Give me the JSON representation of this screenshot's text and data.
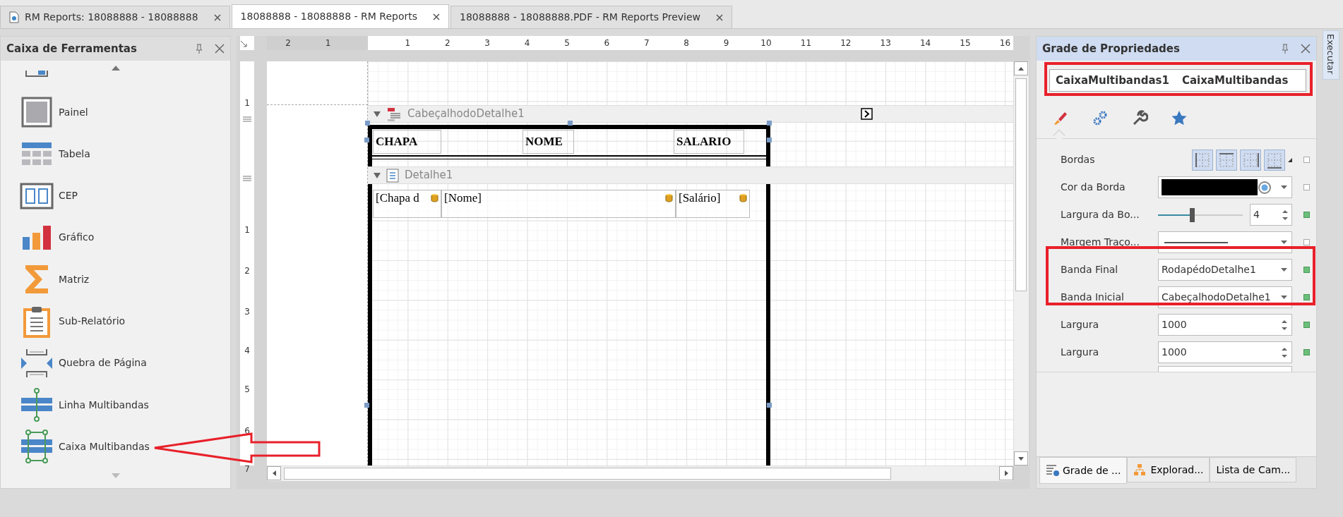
{
  "document_tabs": [
    {
      "label": "RM Reports:  18088888 - 18088888",
      "selected": false,
      "kind": "document"
    },
    {
      "label": "18088888 - 18088888 - RM Reports",
      "selected": true,
      "kind": "plain"
    },
    {
      "label": "18088888 - 18088888.PDF - RM Reports Preview",
      "selected": false,
      "kind": "plain"
    }
  ],
  "toolbox": {
    "title": "Caixa de Ferramentas",
    "items": [
      {
        "kind": "checkbox"
      },
      {
        "kind": "panel",
        "label": "Painel"
      },
      {
        "kind": "table",
        "label": "Tabela"
      },
      {
        "kind": "zip",
        "label": "CEP"
      },
      {
        "kind": "chart",
        "label": "Gráfico"
      },
      {
        "kind": "matrix",
        "label": "Matriz"
      },
      {
        "kind": "subreport",
        "label": "Sub-Relatório"
      },
      {
        "kind": "pagebreak",
        "label": "Quebra de Página"
      },
      {
        "kind": "crossline",
        "label": "Linha Multibandas"
      },
      {
        "kind": "crossbox",
        "label": "Caixa Multibandas"
      }
    ]
  },
  "ruler": {
    "horizontal": [
      "2",
      "1",
      "1",
      "2",
      "3",
      "4",
      "5",
      "6",
      "7",
      "8",
      "9",
      "10",
      "11",
      "12",
      "13",
      "14",
      "15",
      "16"
    ],
    "vertical": [
      "1",
      "1",
      "2",
      "3",
      "4",
      "5",
      "6",
      "7"
    ]
  },
  "design": {
    "bands": [
      {
        "kind": "header",
        "name": "CabeçalhodoDetalhe1",
        "cells": [
          "CHAPA",
          "NOME",
          "SALARIO"
        ]
      },
      {
        "kind": "detail",
        "name": "Detalhe1",
        "cells": [
          "[Chapa d",
          "[Nome]",
          "[Salário]"
        ]
      }
    ]
  },
  "properties": {
    "title": "Grade de Propriedades",
    "selector": {
      "name": "CaixaMultibandas1",
      "type": "CaixaMultibandas"
    },
    "category_tabs": [
      {
        "kind": "appearance",
        "selected": true
      },
      {
        "kind": "behavior",
        "selected": false
      },
      {
        "kind": "data",
        "selected": false
      },
      {
        "kind": "favorites",
        "selected": false
      }
    ],
    "rows": [
      {
        "kind": "borders",
        "label": "Bordas",
        "modified": false
      },
      {
        "kind": "color",
        "label": "Cor da Borda",
        "color": "#000000",
        "modified": false
      },
      {
        "kind": "slider",
        "label": "Largura da Bo...",
        "level": 0.4,
        "value": "4",
        "modified": true
      },
      {
        "kind": "line",
        "label": "Margem Traço...",
        "modified": false
      },
      {
        "kind": "dropdown",
        "label": "Banda Final",
        "value": "RodapédoDetalhe1",
        "modified": true
      },
      {
        "kind": "dropdown",
        "label": "Banda Inicial",
        "value": "CabeçalhodoDetalhe1",
        "modified": true
      },
      {
        "kind": "spin",
        "label": "Largura",
        "value": "1000",
        "modified": true
      },
      {
        "kind": "spin",
        "label": "Largura",
        "value": "1000",
        "modified": true
      }
    ],
    "bottom_tabs": [
      {
        "kind": "grid",
        "label": "Grade de ...",
        "selected": true
      },
      {
        "kind": "explorer",
        "label": "Explorad...",
        "selected": false
      },
      {
        "kind": "fields",
        "label": "Lista de Cam...",
        "selected": false
      }
    ]
  },
  "side_strip": {
    "label": "Executar"
  }
}
